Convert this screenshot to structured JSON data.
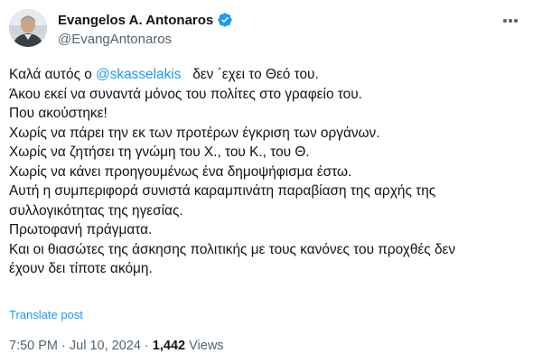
{
  "author": {
    "display_name": "Evangelos A. Antonaros",
    "handle": "@EvangAntonaros",
    "verified_icon": "verified-badge-icon",
    "verified_color": "#1d9bf0"
  },
  "tweet": {
    "line1_prefix": "Καλά αυτός ο ",
    "line1_mention": "@skasselakis",
    "line1_suffix": "   δεν ΄εχει το Θεό του.",
    "lines": [
      "Άκου εκεί να συναντά μόνος του πολίτες στο γραφείο του.",
      "Που ακούστηκε!",
      "Χωρίς να πάρει την εκ των προτέρων έγκριση των οργάνων.",
      "Χωρίς να ζητήσει τη γνώμη του Χ., του Κ., του Θ.",
      "Χωρίς να κάνει προηγουμένως ένα δημοψήφισμα έστω.",
      "Αυτή η συμπεριφορά συνιστά καραμπινάτη παραβίαση της αρχής της",
      "συλλογικότητας της ηγεσίας.",
      "Πρωτοφανή πράγματα.",
      "Και οι θιασώτες της άσκησης πολιτικής με τους κανόνες του προχθές δεν",
      "έχουν δει τίποτε ακόμη."
    ],
    "translate_label": "Translate post",
    "timestamp": "7:50 PM · Jul 10, 2024",
    "separator": " · ",
    "views_count": "1,442",
    "views_label": " Views"
  },
  "colors": {
    "accent": "#1d9bf0",
    "text": "#0f1419",
    "secondary": "#536471"
  }
}
